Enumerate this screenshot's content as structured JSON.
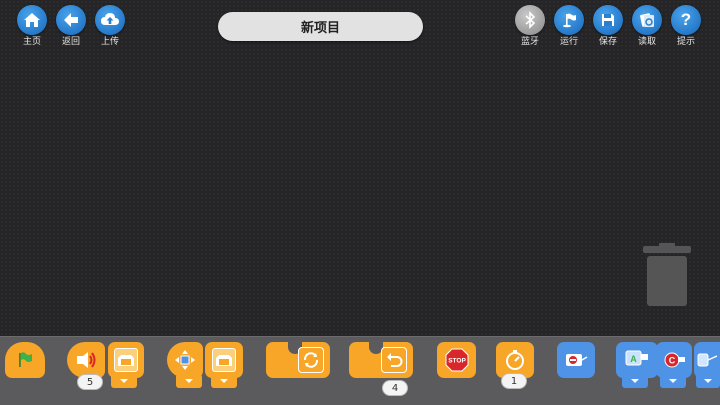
{
  "header": {
    "title": "新项目",
    "left_buttons": [
      {
        "label": "主页",
        "icon": "home-icon"
      },
      {
        "label": "返回",
        "icon": "back-arrow-icon"
      },
      {
        "label": "上传",
        "icon": "cloud-upload-icon"
      }
    ],
    "right_buttons": [
      {
        "label": "蓝牙",
        "icon": "bluetooth-icon",
        "state": "disabled"
      },
      {
        "label": "运行",
        "icon": "flag-run-icon"
      },
      {
        "label": "保存",
        "icon": "floppy-save-icon"
      },
      {
        "label": "读取",
        "icon": "folder-load-icon"
      },
      {
        "label": "提示",
        "icon": "question-icon"
      }
    ]
  },
  "workspace": {
    "trash_icon": "trash-icon"
  },
  "palette": {
    "blocks": [
      {
        "name": "start-flag-block",
        "icon": "green-flag-icon"
      },
      {
        "name": "sound-block",
        "icon": "speaker-icon",
        "value": "5"
      },
      {
        "name": "motor-block",
        "icon": "motor-icon"
      },
      {
        "name": "repeat-forever-block",
        "icon": "loop-icon"
      },
      {
        "name": "repeat-count-block",
        "icon": "undo-loop-icon",
        "value": "4"
      },
      {
        "name": "stop-block",
        "icon": "stop-sign-icon",
        "text": "STOP"
      },
      {
        "name": "wait-timer-block",
        "icon": "stopwatch-icon",
        "value": "1"
      },
      {
        "name": "sensor-block",
        "icon": "sensor-icon"
      }
    ]
  },
  "colors": {
    "accent_blue": "#2a7fcf",
    "block_orange": "#f7a627",
    "block_blue": "#4e93e6",
    "flag_green": "#3bb34a",
    "stop_red": "#d8262b"
  }
}
